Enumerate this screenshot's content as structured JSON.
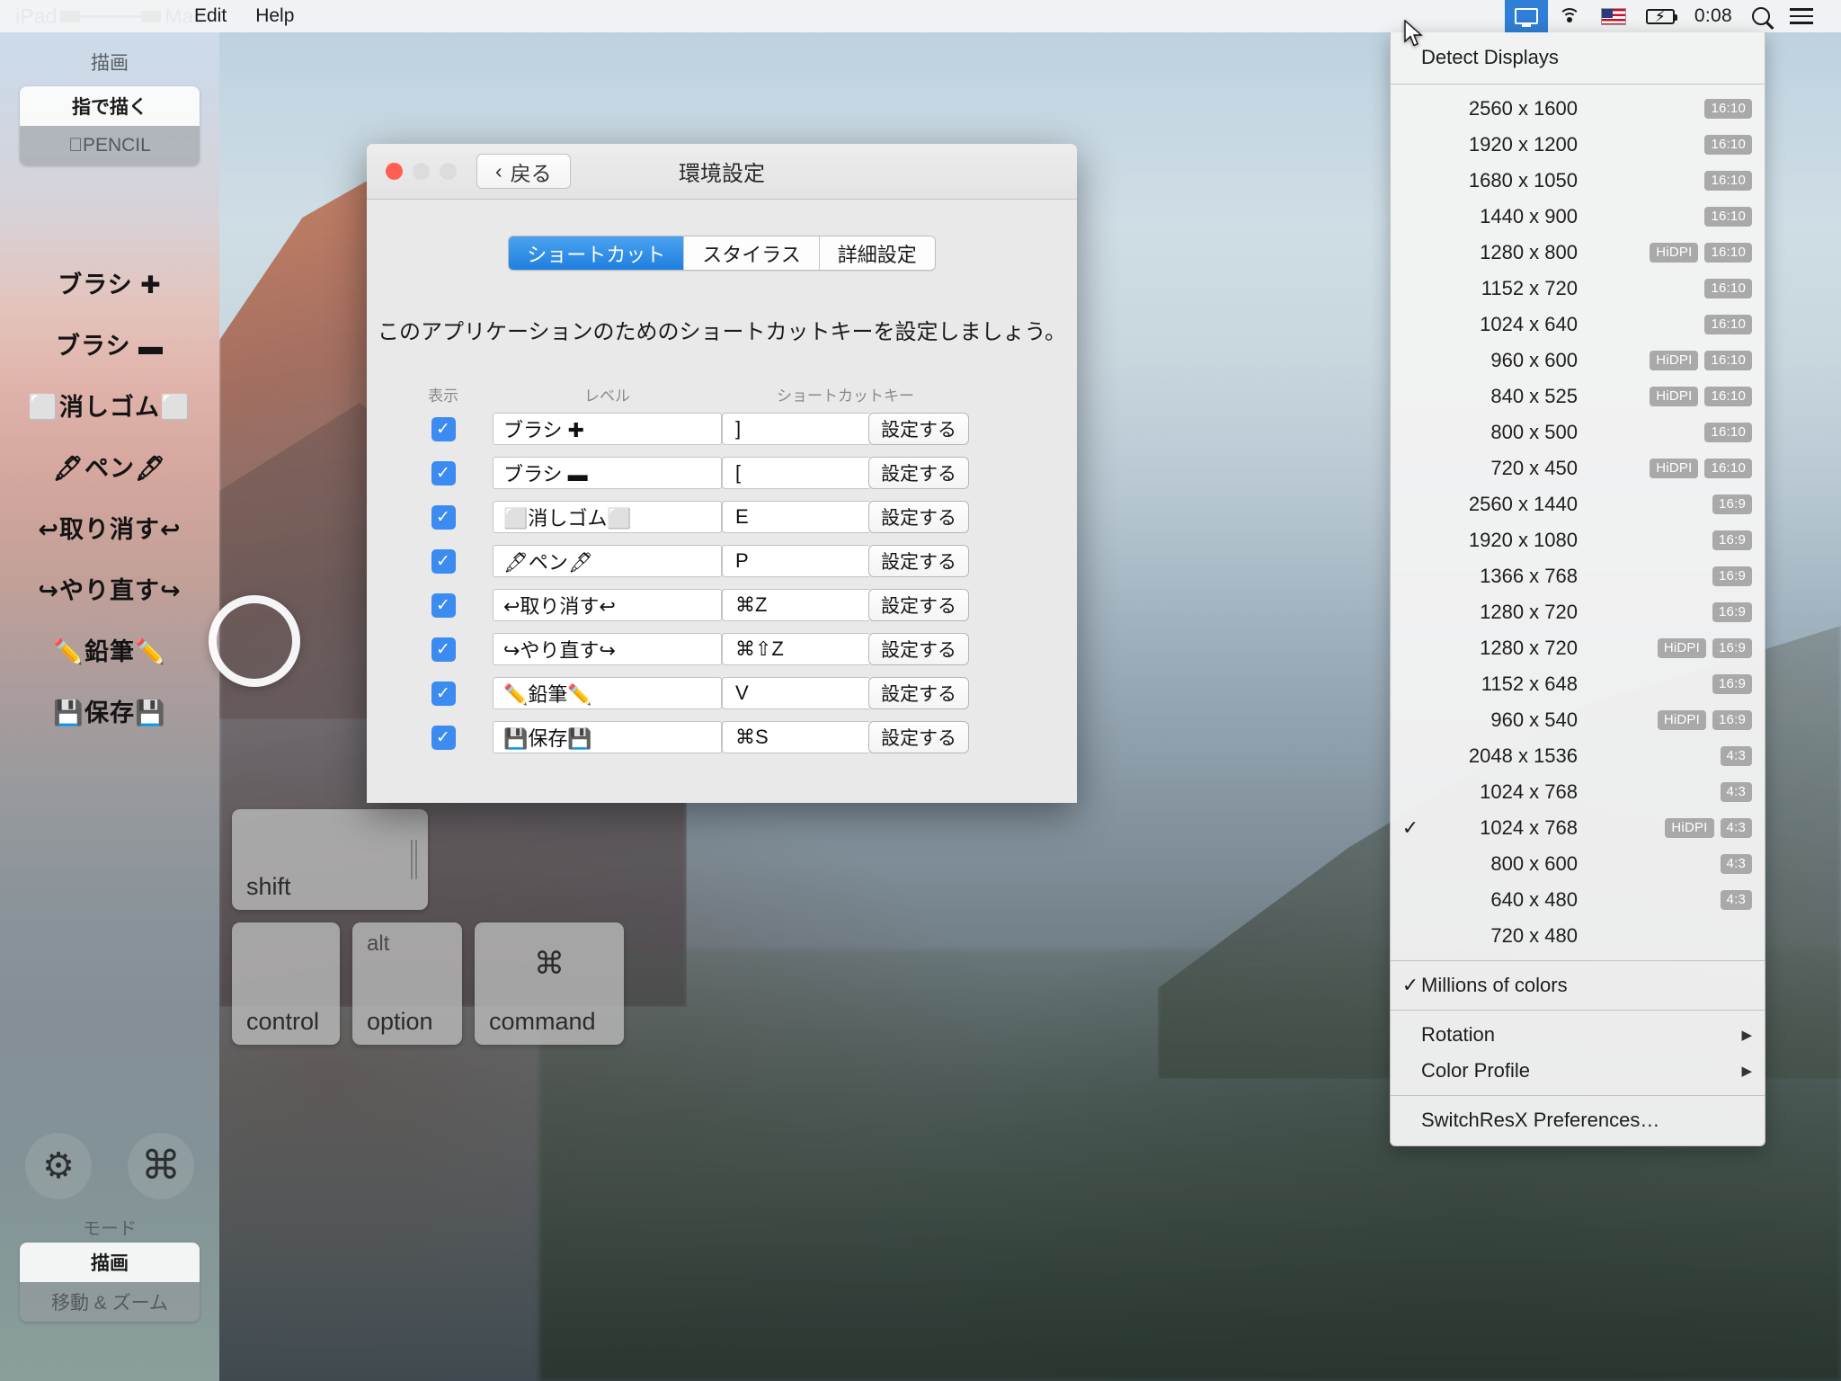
{
  "menubar": {
    "menus": [
      "Edit",
      "Help"
    ],
    "status": {
      "display_icon": "display-icon",
      "wifi_icon": "wifi-icon",
      "flag_icon": "us-flag-icon",
      "battery_icon": "battery-charging-icon",
      "clock": "0:08",
      "search_icon": "search-icon",
      "list_icon": "notification-center-icon"
    }
  },
  "resmenu": {
    "detect": "Detect Displays",
    "items": [
      {
        "check": "",
        "res": "2560 x 1600",
        "hidpi": "",
        "ratio": "16:10"
      },
      {
        "check": "",
        "res": "1920 x 1200",
        "hidpi": "",
        "ratio": "16:10"
      },
      {
        "check": "",
        "res": "1680 x 1050",
        "hidpi": "",
        "ratio": "16:10"
      },
      {
        "check": "",
        "res": "1440 x 900",
        "hidpi": "",
        "ratio": "16:10"
      },
      {
        "check": "",
        "res": "1280 x 800",
        "hidpi": "HiDPI",
        "ratio": "16:10"
      },
      {
        "check": "",
        "res": "1152 x 720",
        "hidpi": "",
        "ratio": "16:10"
      },
      {
        "check": "",
        "res": "1024 x 640",
        "hidpi": "",
        "ratio": "16:10"
      },
      {
        "check": "",
        "res": "960 x 600",
        "hidpi": "HiDPI",
        "ratio": "16:10"
      },
      {
        "check": "",
        "res": "840 x 525",
        "hidpi": "HiDPI",
        "ratio": "16:10"
      },
      {
        "check": "",
        "res": "800 x 500",
        "hidpi": "",
        "ratio": "16:10"
      },
      {
        "check": "",
        "res": "720 x 450",
        "hidpi": "HiDPI",
        "ratio": "16:10"
      },
      {
        "check": "",
        "res": "2560 x 1440",
        "hidpi": "",
        "ratio": "16:9"
      },
      {
        "check": "",
        "res": "1920 x 1080",
        "hidpi": "",
        "ratio": "16:9"
      },
      {
        "check": "",
        "res": "1366 x 768",
        "hidpi": "",
        "ratio": "16:9"
      },
      {
        "check": "",
        "res": "1280 x 720",
        "hidpi": "",
        "ratio": "16:9"
      },
      {
        "check": "",
        "res": "1280 x 720",
        "hidpi": "HiDPI",
        "ratio": "16:9"
      },
      {
        "check": "",
        "res": "1152 x 648",
        "hidpi": "",
        "ratio": "16:9"
      },
      {
        "check": "",
        "res": "960 x 540",
        "hidpi": "HiDPI",
        "ratio": "16:9"
      },
      {
        "check": "",
        "res": "2048 x 1536",
        "hidpi": "",
        "ratio": "4:3"
      },
      {
        "check": "",
        "res": "1024 x 768",
        "hidpi": "",
        "ratio": "4:3"
      },
      {
        "check": "✓",
        "res": "1024 x 768",
        "hidpi": "HiDPI",
        "ratio": "4:3"
      },
      {
        "check": "",
        "res": "800 x 600",
        "hidpi": "",
        "ratio": "4:3"
      },
      {
        "check": "",
        "res": "640 x 480",
        "hidpi": "",
        "ratio": "4:3"
      },
      {
        "check": "",
        "res": "720 x 480",
        "hidpi": "",
        "ratio": ""
      }
    ],
    "colors": {
      "check": "✓",
      "label": "Millions of colors"
    },
    "rotation": {
      "label": "Rotation",
      "arrow": "▶"
    },
    "color_profile": {
      "label": "Color Profile",
      "arrow": "▶"
    },
    "preferences": "SwitchResX Preferences…"
  },
  "sidebar": {
    "device_left": "iPad",
    "device_right": "Mac",
    "draw_title": "描画",
    "input_modes": {
      "finger": "指で描く",
      "pencil": "PENCIL",
      "pencil_prefix": ""
    },
    "tools": [
      {
        "label": "ブラシ ✚"
      },
      {
        "label": "ブラシ ▬"
      },
      {
        "label": "⬜消しゴム⬜"
      },
      {
        "label": "🖋ペン🖋"
      },
      {
        "label": "↩取り消す↩"
      },
      {
        "label": "↪やり直す↪"
      },
      {
        "label": "✏️鉛筆✏️"
      },
      {
        "label": "💾保存💾"
      }
    ],
    "gear_icon": "gear-icon",
    "command_icon": "command-icon",
    "mode_label": "モード",
    "modes": {
      "draw": "描画",
      "pan": "移動 & ズーム"
    }
  },
  "prefs": {
    "back": "戻る",
    "back_chevron": "‹",
    "title": "環境設定",
    "tabs": [
      {
        "label": "ショートカット",
        "active": true
      },
      {
        "label": "スタイラス",
        "active": false
      },
      {
        "label": "詳細設定",
        "active": false
      }
    ],
    "intro": "このアプリケーションのためのショートカットキーを設定しましょう。",
    "columns": {
      "show": "表示",
      "level": "レベル",
      "key": "ショートカットキー"
    },
    "set_button": "設定する",
    "checkmark": "✓",
    "rows": [
      {
        "checked": true,
        "level": "ブラシ ✚",
        "key": "]"
      },
      {
        "checked": true,
        "level": "ブラシ ▬",
        "key": "["
      },
      {
        "checked": true,
        "level": "⬜消しゴム⬜",
        "key": "E"
      },
      {
        "checked": true,
        "level": "🖋ペン🖋",
        "key": "P"
      },
      {
        "checked": true,
        "level": "↩取り消す↩",
        "key": "⌘Z"
      },
      {
        "checked": true,
        "level": "↪やり直す↪",
        "key": "⌘⇧Z"
      },
      {
        "checked": true,
        "level": "✏️鉛筆✏️",
        "key": "V"
      },
      {
        "checked": true,
        "level": "💾保存💾",
        "key": "⌘S"
      }
    ]
  },
  "keyboard": {
    "shift": "shift",
    "control": "control",
    "option_top": "alt",
    "option": "option",
    "command": "command",
    "command_glyph": "⌘"
  }
}
